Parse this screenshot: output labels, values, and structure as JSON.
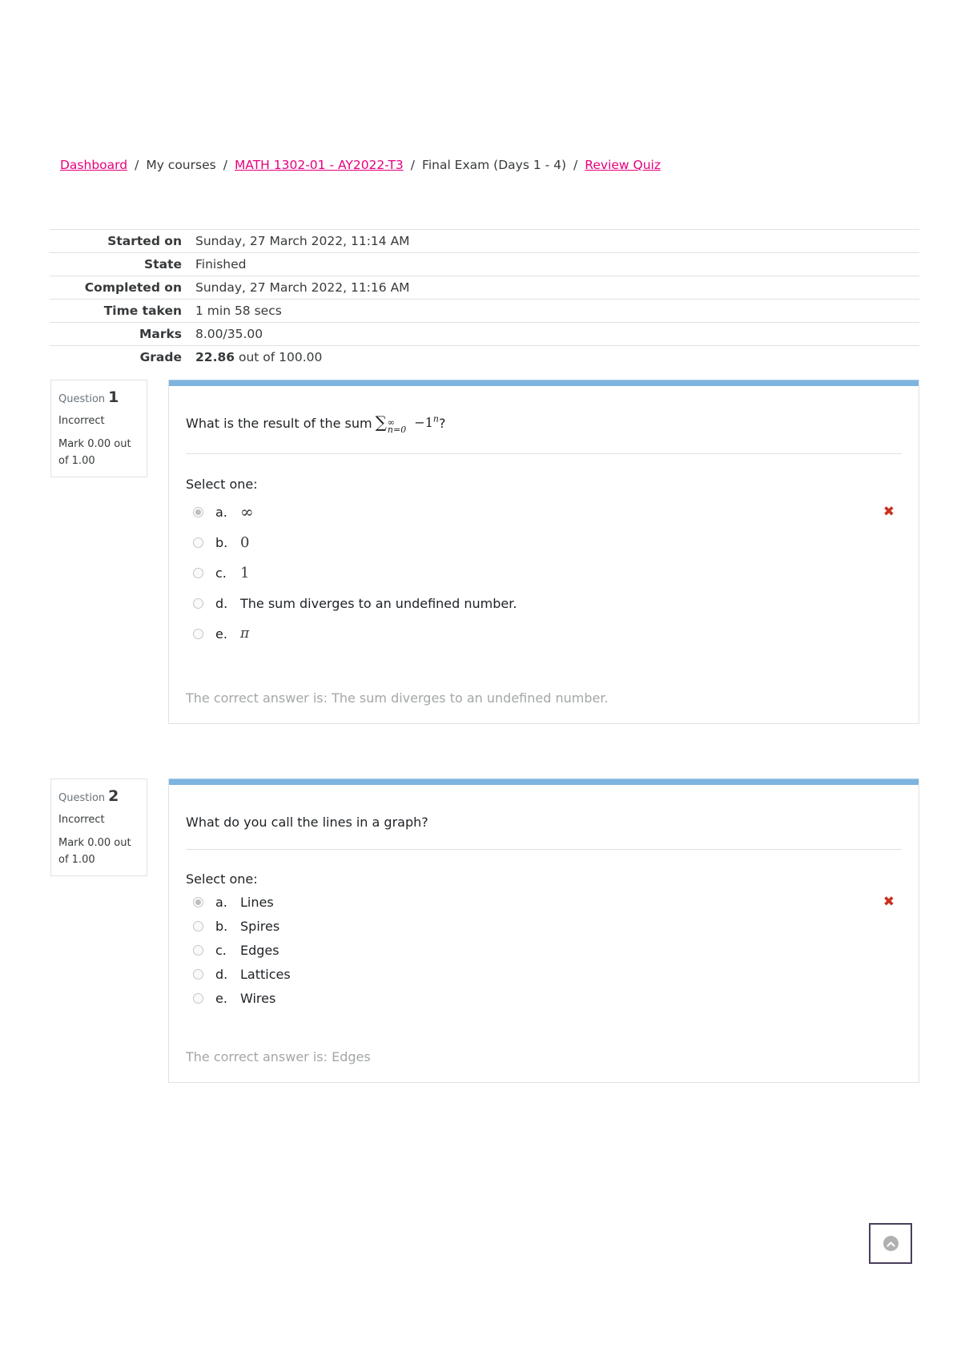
{
  "breadcrumb": [
    {
      "label": "Dashboard",
      "link": true
    },
    {
      "label": "My courses",
      "link": false
    },
    {
      "label": "MATH 1302-01 - AY2022-T3",
      "link": true
    },
    {
      "label": "Final Exam (Days 1 - 4)",
      "link": false
    },
    {
      "label": "Review Quiz",
      "link": true
    }
  ],
  "breadcrumb_separator": "/",
  "summary": {
    "started_on": {
      "label": "Started on",
      "value": "Sunday, 27 March 2022, 11:14 AM"
    },
    "state": {
      "label": "State",
      "value": "Finished"
    },
    "completed_on": {
      "label": "Completed on",
      "value": "Sunday, 27 March 2022, 11:16 AM"
    },
    "time_taken": {
      "label": "Time taken",
      "value": "1 min 58 secs"
    },
    "marks": {
      "label": "Marks",
      "value": "8.00/35.00"
    },
    "grade": {
      "label": "Grade",
      "value_bold": "22.86",
      "value_rest": " out of 100.00"
    }
  },
  "questions": [
    {
      "label": "Question",
      "number": "1",
      "state": "Incorrect",
      "grade": "Mark 0.00 out of 1.00",
      "text_prefix": "What is the result of the sum",
      "math": {
        "sigma": "∑",
        "upper": "∞",
        "lower": "n=0",
        "body": "−1",
        "exp": "n"
      },
      "text_suffix": "?",
      "prompt": "Select one:",
      "options": [
        {
          "letter": "a.",
          "text": "∞",
          "math": true,
          "checked": true
        },
        {
          "letter": "b.",
          "text": "0",
          "math": true,
          "checked": false
        },
        {
          "letter": "c.",
          "text": "1",
          "math": true,
          "checked": false
        },
        {
          "letter": "d.",
          "text": "The sum diverges to an undefined number.",
          "math": false,
          "checked": false
        },
        {
          "letter": "e.",
          "text": "π",
          "math": true,
          "checked": false
        }
      ],
      "feedback_icon": "✖",
      "right_answer": "The correct answer is: The sum diverges to an undefined number."
    },
    {
      "label": "Question",
      "number": "2",
      "state": "Incorrect",
      "grade": "Mark 0.00 out of 1.00",
      "text": "What do you call the lines in a graph?",
      "prompt": "Select one:",
      "options": [
        {
          "letter": "a.",
          "text": "Lines",
          "checked": true
        },
        {
          "letter": "b.",
          "text": "Spires",
          "checked": false
        },
        {
          "letter": "c.",
          "text": "Edges",
          "checked": false
        },
        {
          "letter": "d.",
          "text": "Lattices",
          "checked": false
        },
        {
          "letter": "e.",
          "text": "Wires",
          "checked": false
        }
      ],
      "feedback_icon": "✖",
      "right_answer": "The correct answer is: Edges"
    }
  ],
  "colors": {
    "link": "#e6007e",
    "question_bar": "#7db4df",
    "incorrect": "#ca3120",
    "right_answer_text": "#a3a6a8"
  },
  "back_to_top": {
    "icon": "chevron-up-circle"
  }
}
